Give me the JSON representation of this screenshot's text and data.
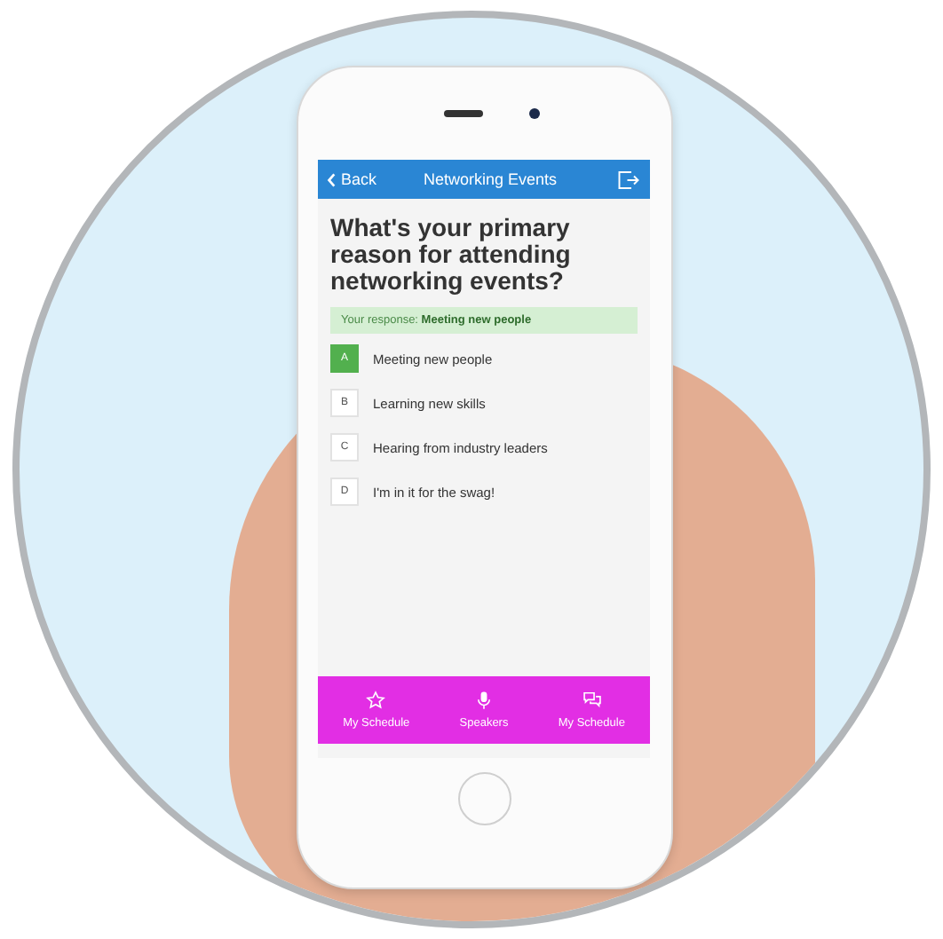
{
  "header": {
    "back": "Back",
    "title": "Networking Events"
  },
  "question": "What's your primary reason for attending networking events?",
  "response": "Your response: **Meeting new people**",
  "options": [
    {
      "letter": "A",
      "text": "Meeting new people",
      "selected": true
    },
    {
      "letter": "B",
      "text": "Learning new skills",
      "selected": false
    },
    {
      "letter": "C",
      "text": "Hearing from industry leaders",
      "selected": false
    },
    {
      "letter": "D",
      "text": "I'm in it for the swag!",
      "selected": false
    }
  ],
  "tabs": [
    {
      "kind": "star",
      "label": "My Schedule"
    },
    {
      "kind": "mic",
      "label": "Speakers"
    },
    {
      "kind": "chat",
      "label": "My Schedule"
    }
  ]
}
